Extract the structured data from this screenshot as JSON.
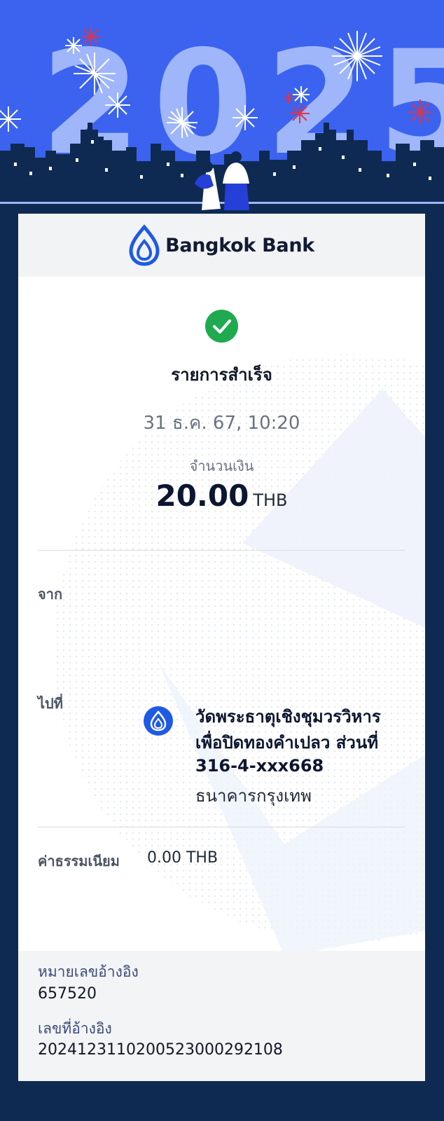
{
  "banner": {
    "year": "2025"
  },
  "brand": {
    "name": "Bangkok Bank"
  },
  "transaction": {
    "status": "รายการสำเร็จ",
    "datetime": "31 ธ.ค. 67, 10:20",
    "amount_label": "จำนวนเงิน",
    "amount": "20.00",
    "currency": "THB"
  },
  "from": {
    "label": "จาก"
  },
  "to": {
    "label": "ไปที่",
    "name_line1": "วัดพระธาตุเชิงชุมวรวิหาร",
    "name_line2": "เพื่อปิดทองคำเปลว ส่วนที่",
    "account": "316-4-xxx668",
    "bank": "ธนาคารกรุงเทพ"
  },
  "fee": {
    "label": "ค่าธรรมเนียม",
    "value": "0.00 THB"
  },
  "reference": {
    "ref1_label": "หมายเลขอ้างอิง",
    "ref1_value": "657520",
    "ref2_label": "เลขที่อ้างอิง",
    "ref2_value": "20241231102005230002921​08"
  },
  "colors": {
    "brand_blue": "#1e5ae6",
    "success_green": "#1faa4f",
    "banner_blue": "#3b63f0",
    "navy": "#0f2a52"
  }
}
